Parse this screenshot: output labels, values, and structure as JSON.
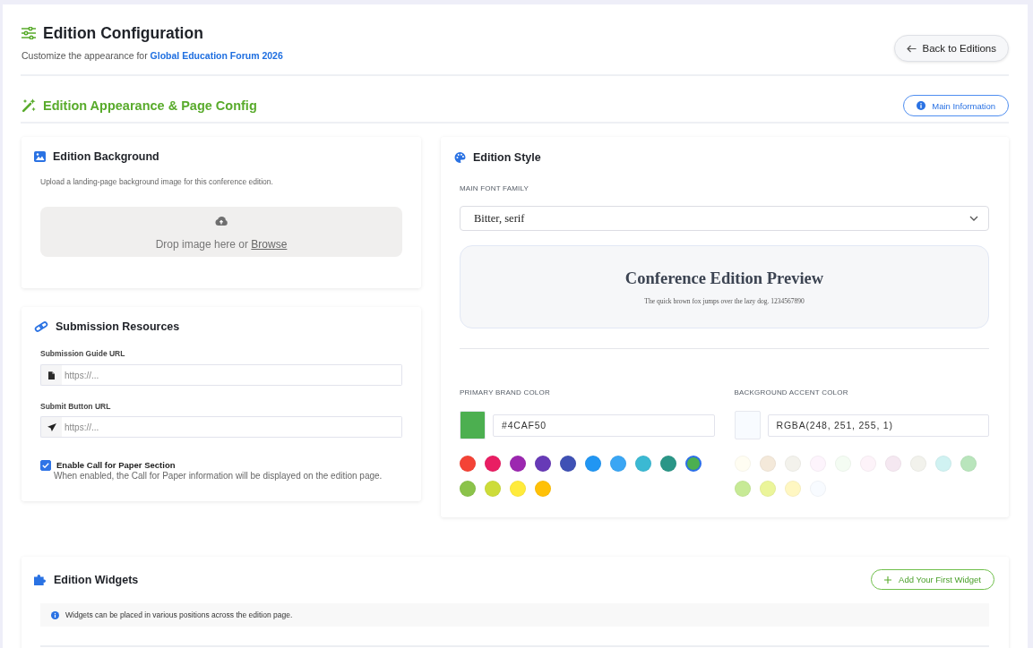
{
  "header": {
    "title": "Edition Configuration",
    "subtitle": "Customize the appearance for **Global Education Forum 2026**",
    "back_button": "Back to Editions"
  },
  "section": {
    "title": "Edition Appearance & Page Config",
    "main_info_button": "Main Information"
  },
  "background_card": {
    "title": "Edition Background",
    "description": "Upload a landing-page background image for this conference edition.",
    "dropzone": {
      "text": "Drop image here or",
      "link": "Browse"
    }
  },
  "resources_card": {
    "title": "Submission Resources",
    "fields": [
      {
        "label": "Submission Guide URL",
        "placeholder": "https://..."
      },
      {
        "label": "Submit Button URL",
        "placeholder": "https://..."
      }
    ],
    "call_for_paper": {
      "label": "Enable Call for Paper Section",
      "description": "When enabled, the Call for Paper information will be displayed on the edition page.",
      "checked": true
    }
  },
  "style_card": {
    "title": "Edition Style",
    "font_label": "MAIN FONT FAMILY",
    "font_value": "Bitter, serif",
    "preview": {
      "title": "Conference Edition Preview",
      "sample": "The quick brown fox jumps over the lazy dog. 1234567890"
    },
    "color_pickers": [
      {
        "label": "PRIMARY BRAND COLOR",
        "value": "#4CAF50",
        "color": "#4caf50",
        "palette": [
          {
            "color": "#f44336",
            "selected": false
          },
          {
            "color": "#e91e63",
            "selected": false
          },
          {
            "color": "#9c27b0",
            "selected": false
          },
          {
            "color": "#673ab7",
            "selected": false
          },
          {
            "color": "#3f51b5",
            "selected": false
          },
          {
            "color": "#2196f3",
            "selected": false
          },
          {
            "color": "#3aa6f4",
            "selected": false
          },
          {
            "color": "#3bb9d3",
            "selected": false
          },
          {
            "color": "#2a9687",
            "selected": false
          },
          {
            "color": "#4caf50",
            "selected": true
          },
          {
            "color": "#8bc34a",
            "selected": false
          },
          {
            "color": "#cddc39",
            "selected": false
          },
          {
            "color": "#ffeb3b",
            "selected": false
          },
          {
            "color": "#ffc107",
            "selected": false
          }
        ]
      },
      {
        "label": "BACKGROUND ACCENT COLOR",
        "value": "RGBA(248, 251, 255, 1)",
        "color": "#f8fbff",
        "palette": [
          {
            "color": "#fffdf2",
            "selected": false
          },
          {
            "color": "#f4e9da",
            "selected": false
          },
          {
            "color": "#f3f2ec",
            "selected": false
          },
          {
            "color": "#fdf4fc",
            "selected": false
          },
          {
            "color": "#f4fcf3",
            "selected": false
          },
          {
            "color": "#fdf3f9",
            "selected": false
          },
          {
            "color": "#f5e8f1",
            "selected": false
          },
          {
            "color": "#f2f2ec",
            "selected": false
          },
          {
            "color": "#d0f2f2",
            "selected": false
          },
          {
            "color": "#b9e5bc",
            "selected": false
          },
          {
            "color": "#c7ea96",
            "selected": false
          },
          {
            "color": "#ebf59a",
            "selected": false
          },
          {
            "color": "#fff7c2",
            "selected": false
          },
          {
            "color": "#f8fbff",
            "selected": false
          }
        ]
      }
    ]
  },
  "widgets_card": {
    "title": "Edition Widgets",
    "add_button": "Add Your First Widget",
    "info": "Widgets can be placed in various positions across the edition page."
  }
}
